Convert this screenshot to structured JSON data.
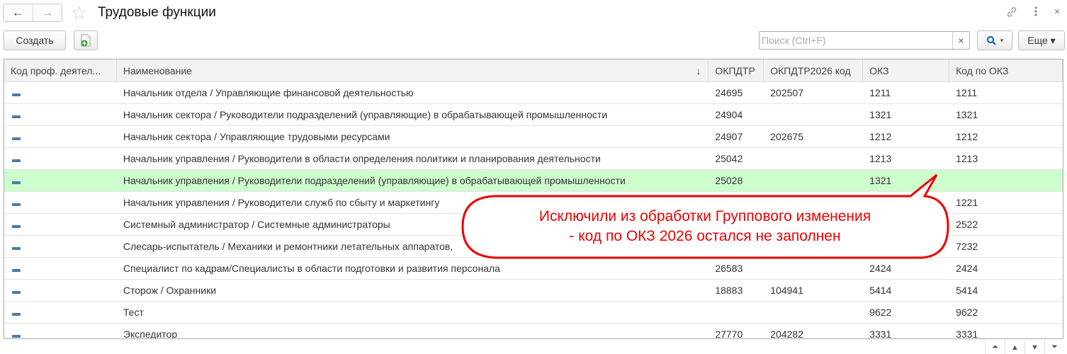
{
  "header": {
    "title": "Трудовые функции",
    "back_icon": "←",
    "forward_icon": "→"
  },
  "toolbar": {
    "create_label": "Создать",
    "search_placeholder": "Поиск (Ctrl+F)",
    "clear": "×",
    "more_label": "Еще ▾",
    "search_btn": "▾"
  },
  "columns": [
    "Код проф. деятел...",
    "Наименование",
    "ОКПДТР",
    "ОКПДТР2026 код",
    "ОКЗ",
    "Код по ОКЗ"
  ],
  "rows": [
    [
      "",
      "Начальник отдела / Управляющие финансовой деятельностью",
      "24695",
      "202507",
      "1211",
      "1211"
    ],
    [
      "",
      "Начальник сектора / Руководители подразделений (управляющие) в обрабатывающей промышленности",
      "24904",
      "",
      "1321",
      "1321"
    ],
    [
      "",
      "Начальник сектора / Управляющие трудовыми ресурсами",
      "24907",
      "202675",
      "1212",
      "1212"
    ],
    [
      "",
      "Начальник управления / Руководители в области определения политики и планирования деятельности",
      "25042",
      "",
      "1213",
      "1213"
    ],
    [
      "",
      "Начальник управления / Руководители подразделений (управляющие) в обрабатывающей промышленности",
      "25028",
      "",
      "1321",
      ""
    ],
    [
      "",
      "Начальник управления / Руководители служб по сбыту и маркетингу",
      "",
      "",
      "",
      "1221"
    ],
    [
      "",
      "Системный администратор / Системные администраторы",
      "",
      "",
      "",
      "2522"
    ],
    [
      "",
      "Слесарь-испытатель / Механики и ремонтники летательных аппаратов,",
      "",
      "",
      "",
      "7232"
    ],
    [
      "",
      "Специалист по кадрам/Специалисты в области подготовки и развития персонала",
      "26583",
      "",
      "2424",
      "2424"
    ],
    [
      "",
      "Сторож / Охранники",
      "18883",
      "104941",
      "5414",
      "5414"
    ],
    [
      "",
      "Тест",
      "",
      "",
      "9622",
      "9622"
    ],
    [
      "",
      "Экспедитор",
      "27770",
      "204282",
      "3331",
      "3331"
    ]
  ],
  "selected_row": 4,
  "callout": {
    "line1": "Исключили из обработки Группового изменения",
    "line2": "- код по ОКЗ 2026 остался не заполнен"
  },
  "colors": {
    "selected": "#cdfccd",
    "callout": "#e00000"
  }
}
